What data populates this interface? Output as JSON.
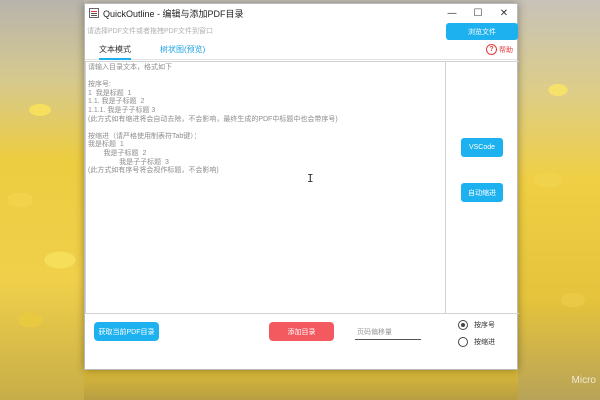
{
  "window": {
    "title": "QuickOutline - 编辑与添加PDF目录",
    "controls": {
      "minimize": "—",
      "maximize": "☐",
      "close": "✕"
    }
  },
  "header": {
    "hint": "请选择PDF文件或者拖拽PDF文件到窗口",
    "browse_label": "浏览文件"
  },
  "tabs": [
    {
      "label": "文本模式",
      "active": true
    },
    {
      "label": "树状图(预览)",
      "active": false
    }
  ],
  "help": {
    "label": "帮助",
    "icon": "?"
  },
  "editor": {
    "lines": [
      "请输入目录文本，格式如下",
      "",
      "按序号:",
      "1  我是标题  1",
      "1.1. 我是子标题  2",
      "1.1.1. 我是子子标题 3",
      "(此方式如有缩进将会自动去除，不会影响，最终生成的PDF中标题中也会带序号)",
      "",
      "按缩进（请严格使用制表符Tab键）：",
      "我是标题  1",
      "        我是子标题  2",
      "                我是子子标题  3",
      "(此方式如有序号将会视作标题，不会影响)"
    ],
    "cursor": "I"
  },
  "side": {
    "vscode_label": "VSCode",
    "auto_indent_label": "自动缩进"
  },
  "bottom": {
    "fetch_label": "获取当前PDF目录",
    "add_label": "添加目录",
    "offset_placeholder": "页码偏移量",
    "radios": [
      {
        "label": "按序号",
        "checked": true
      },
      {
        "label": "按缩进",
        "checked": false
      }
    ]
  },
  "watermark": "Micro",
  "colors": {
    "accent": "#1eb1f0",
    "danger": "#f25a5f",
    "help": "#e03a3a"
  }
}
